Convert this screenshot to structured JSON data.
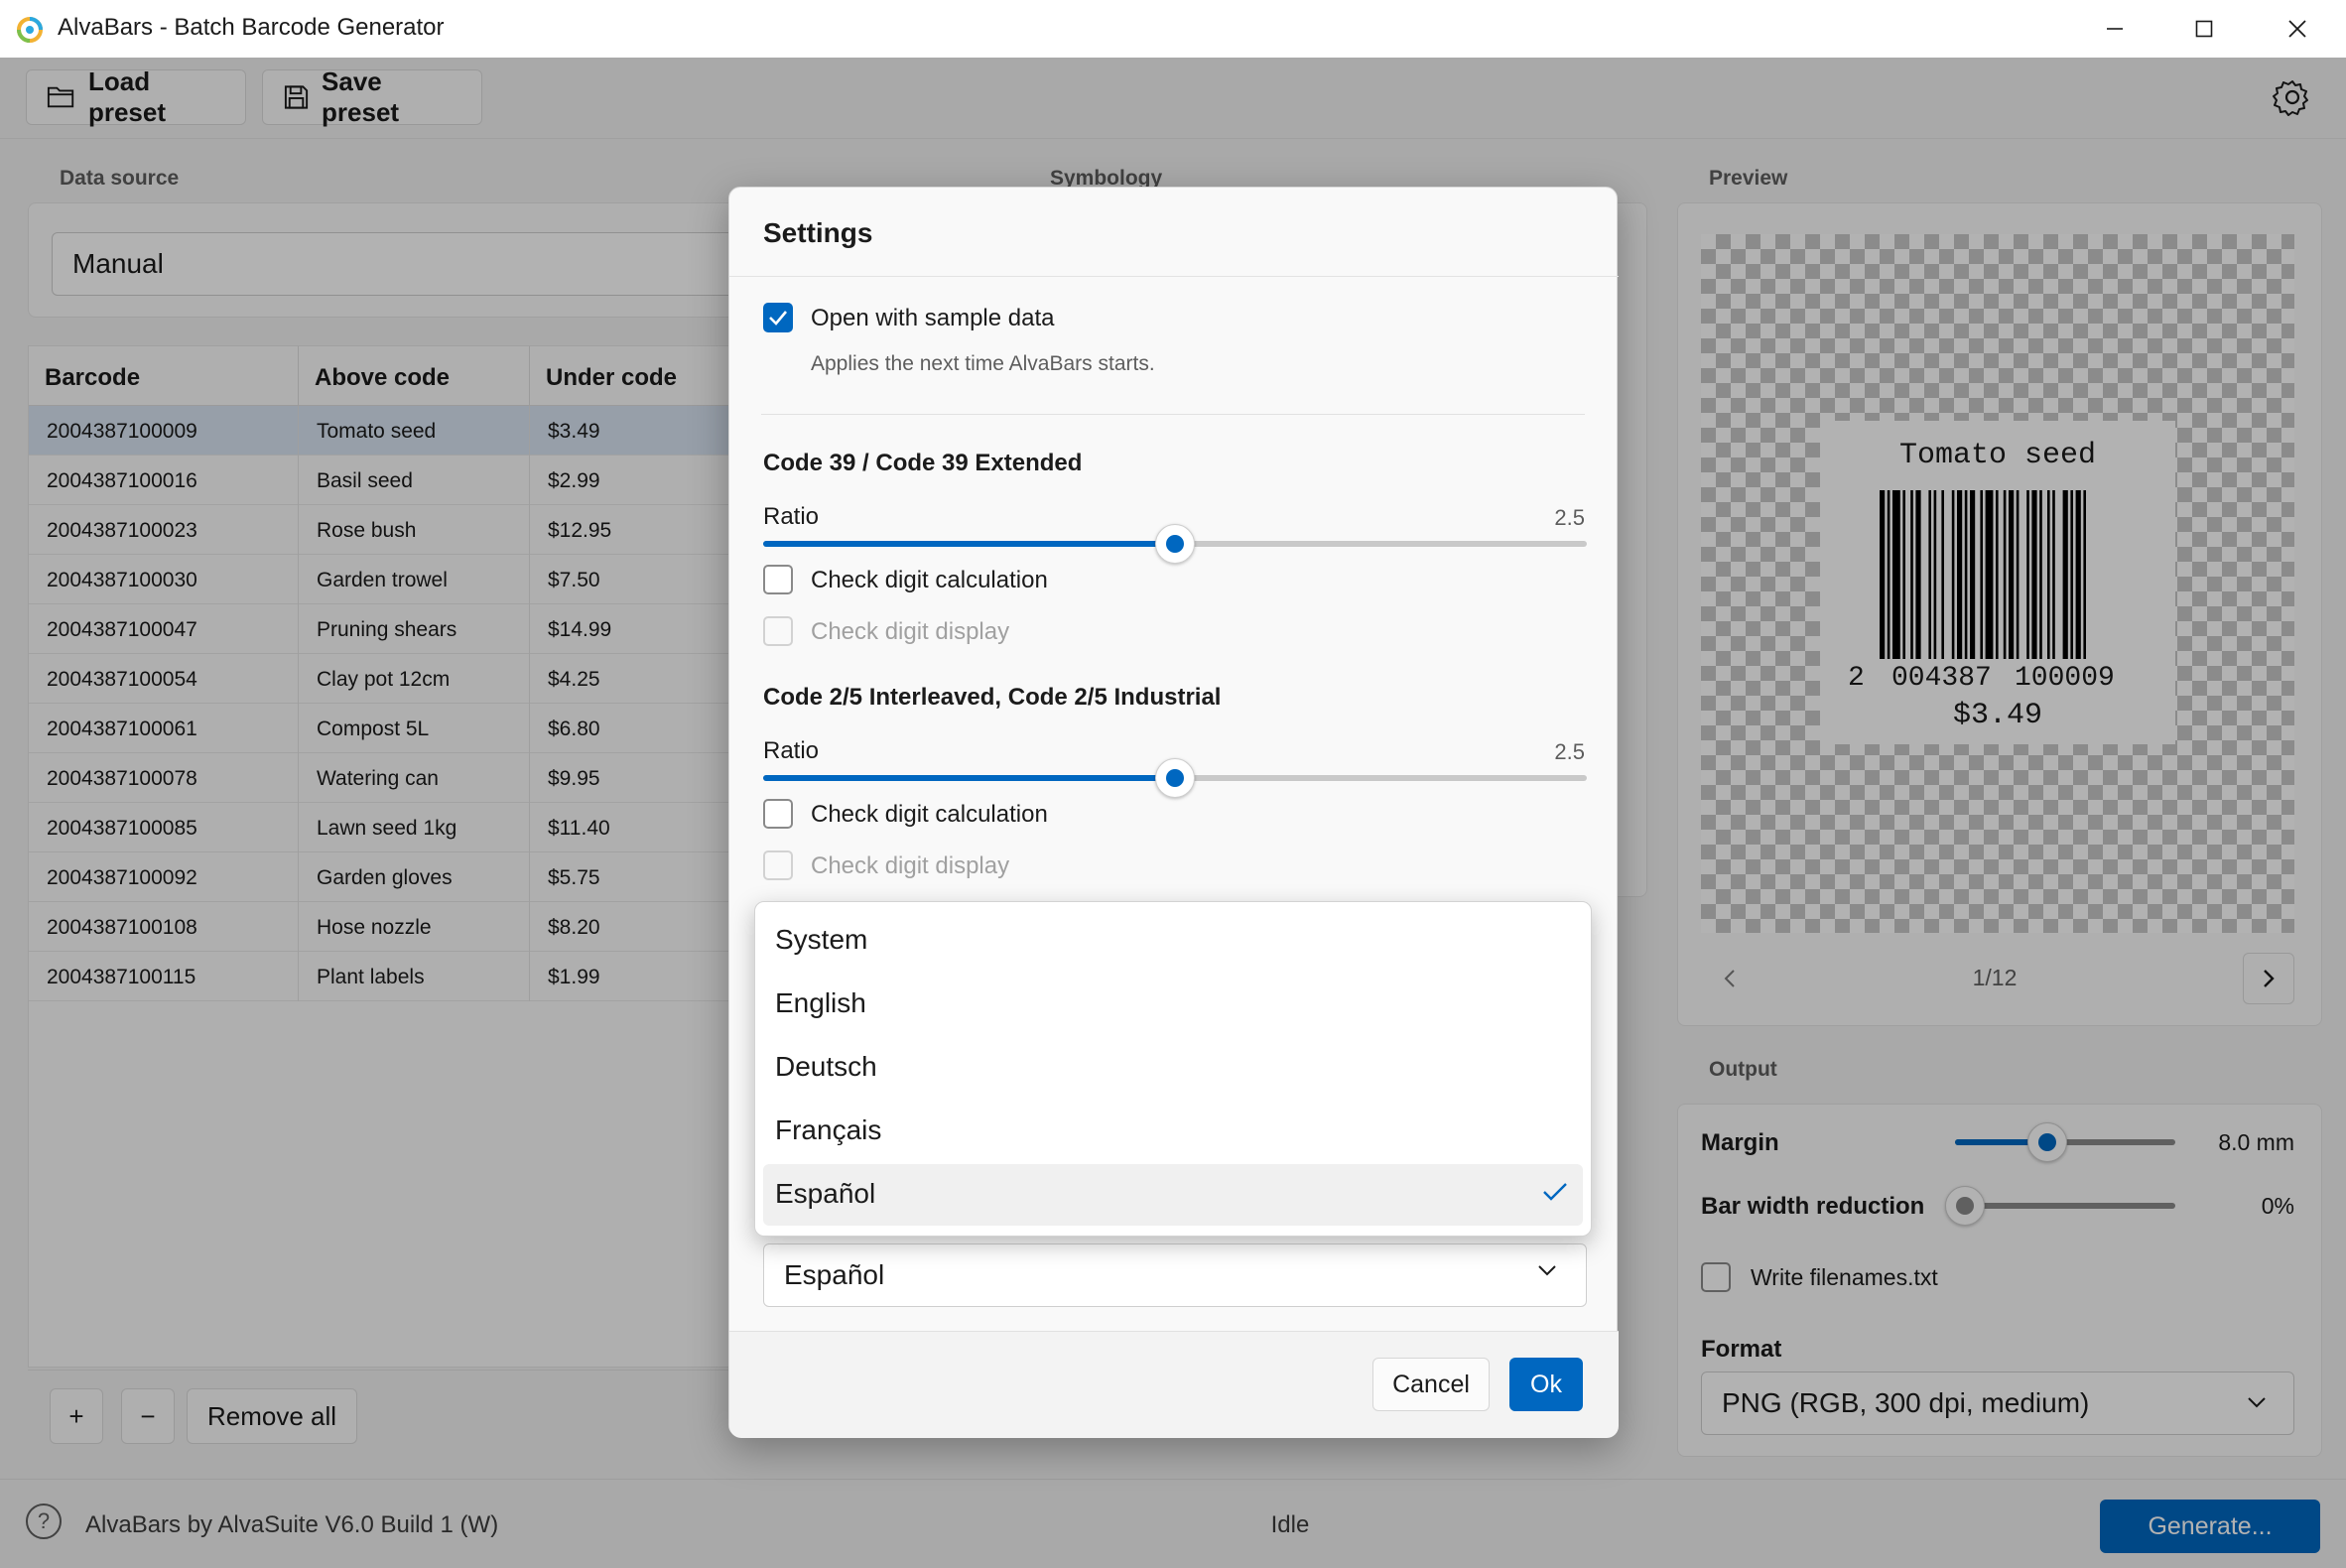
{
  "window": {
    "title": "AlvaBars - Batch Barcode Generator"
  },
  "toolbar": {
    "load_label": "Load preset",
    "save_label": "Save preset"
  },
  "data_source": {
    "section_label": "Data source",
    "value": "Manual"
  },
  "grid": {
    "headers": [
      "Barcode",
      "Above code",
      "Under code"
    ],
    "rows": [
      [
        "2004387100009",
        "Tomato seed",
        "$3.49"
      ],
      [
        "2004387100016",
        "Basil seed",
        "$2.99"
      ],
      [
        "2004387100023",
        "Rose bush",
        "$12.95"
      ],
      [
        "2004387100030",
        "Garden trowel",
        "$7.50"
      ],
      [
        "2004387100047",
        "Pruning shears",
        "$14.99"
      ],
      [
        "2004387100054",
        "Clay pot 12cm",
        "$4.25"
      ],
      [
        "2004387100061",
        "Compost 5L",
        "$6.80"
      ],
      [
        "2004387100078",
        "Watering can",
        "$9.95"
      ],
      [
        "2004387100085",
        "Lawn seed 1kg",
        "$11.40"
      ],
      [
        "2004387100092",
        "Garden gloves",
        "$5.75"
      ],
      [
        "2004387100108",
        "Hose nozzle",
        "$8.20"
      ],
      [
        "2004387100115",
        "Plant labels",
        "$1.99"
      ]
    ],
    "selected_row": 0,
    "add_label": "+",
    "remove_label": "−",
    "remove_all_label": "Remove all"
  },
  "symbology": {
    "section_label": "Symbology"
  },
  "preview": {
    "section_label": "Preview",
    "above_text": "Tomato seed",
    "digit_first": "2",
    "digits_left": "004387",
    "digits_right": "100009",
    "under_text": "$3.49",
    "page": "1/12"
  },
  "output": {
    "section_label": "Output",
    "margin_label": "Margin",
    "margin_value": "8.0 mm",
    "margin_fraction": 0.42,
    "bwr_label": "Bar width reduction",
    "bwr_value": "0%",
    "bwr_fraction": 0.0,
    "write_filenames_label": "Write filenames.txt",
    "format_label": "Format",
    "format_value": "PNG (RGB, 300 dpi, medium)"
  },
  "statusbar": {
    "version": "AlvaBars by AlvaSuite V6.0 Build 1 (W)",
    "status": "Idle",
    "generate_label": "Generate..."
  },
  "settings_dialog": {
    "title": "Settings",
    "open_sample_label": "Open with sample data",
    "open_sample_checked": true,
    "open_sample_hint": "Applies the next time AlvaBars starts.",
    "code39": {
      "heading": "Code 39 / Code 39 Extended",
      "ratio_label": "Ratio",
      "ratio_value": "2.5",
      "ratio_fraction": 0.5,
      "check_calc_label": "Check digit calculation",
      "check_display_label": "Check digit display"
    },
    "code25": {
      "heading": "Code 2/5 Interleaved, Code 2/5 Industrial",
      "ratio_label": "Ratio",
      "ratio_value": "2.5",
      "ratio_fraction": 0.5,
      "check_calc_label": "Check digit calculation",
      "check_display_label": "Check digit display"
    },
    "language_value": "Español",
    "language_options": [
      "System",
      "English",
      "Deutsch",
      "Français",
      "Español"
    ],
    "language_selected_index": 4,
    "cancel_label": "Cancel",
    "ok_label": "Ok"
  },
  "colors": {
    "accent": "#0067c0",
    "selection": "#d8e4f2"
  }
}
